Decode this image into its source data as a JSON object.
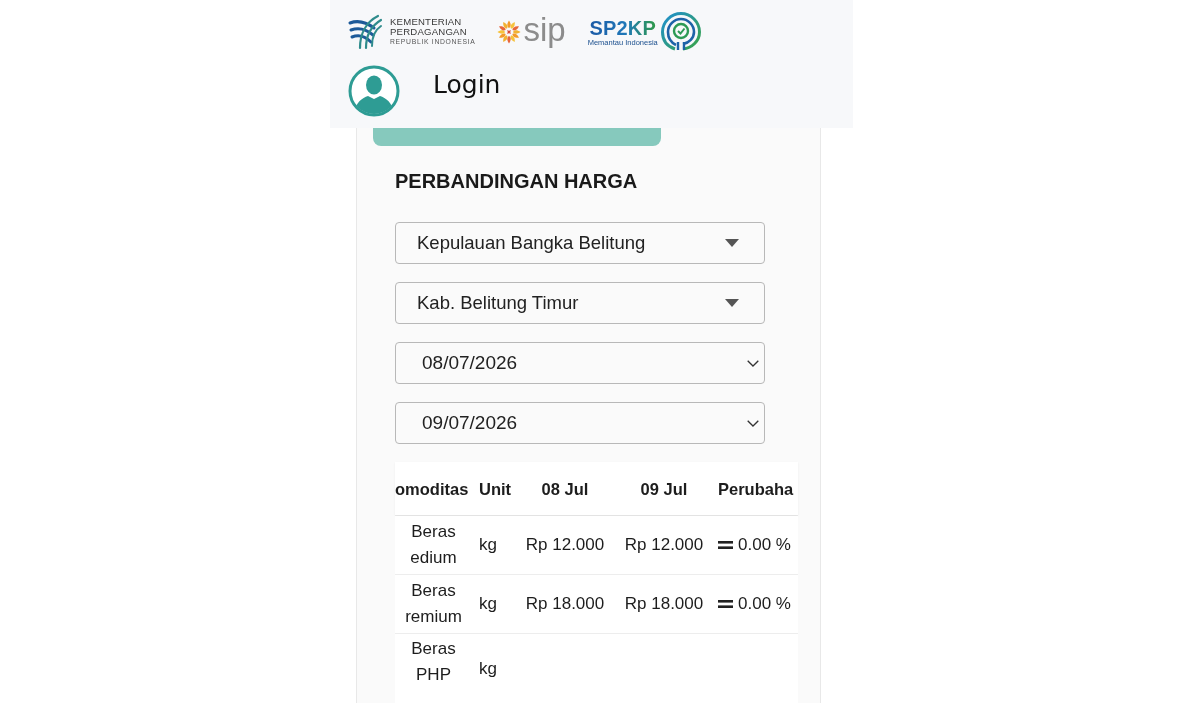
{
  "header": {
    "logos": [
      {
        "kind": "ministry",
        "lines": [
          "KEMENTERIAN",
          "PERDAGANGAN",
          "REPUBLIK INDONESIA"
        ]
      },
      {
        "kind": "sip",
        "text": "sip"
      },
      {
        "kind": "sp2kp",
        "text": "SP2KP",
        "tagline": "Memantau Indonesia"
      }
    ],
    "login": "Login"
  },
  "panel": {
    "title": "PERBANDINGAN HARGA",
    "filters": [
      {
        "kind": "dropdown",
        "value": "Kepulauan Bangka Belitung"
      },
      {
        "kind": "dropdown",
        "value": "Kab. Belitung Timur"
      },
      {
        "kind": "date",
        "value": "08/07/2026"
      },
      {
        "kind": "date",
        "value": "09/07/2026"
      }
    ],
    "table": {
      "columns": [
        "omoditas",
        "Unit",
        "08 Jul",
        "09 Jul",
        "Perubaha"
      ],
      "rows": [
        {
          "commodity": "Beras edium",
          "unit": "kg",
          "price_1": "Rp 12.000",
          "price_2": "Rp 12.000",
          "change": "0.00 %"
        },
        {
          "commodity": "Beras remium",
          "unit": "kg",
          "price_1": "Rp 18.000",
          "price_2": "Rp 18.000",
          "change": "0.00 %"
        },
        {
          "commodity": "Beras PHP",
          "unit": "kg"
        }
      ]
    }
  }
}
